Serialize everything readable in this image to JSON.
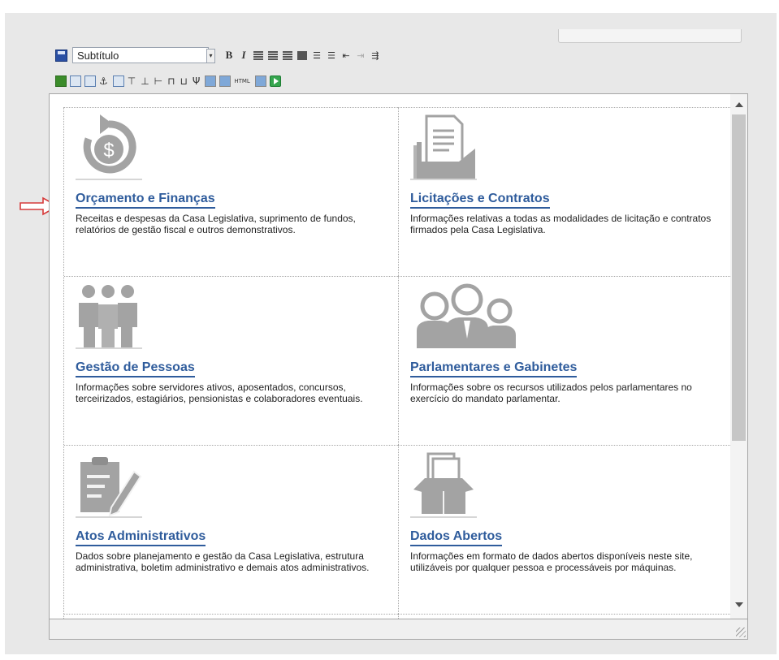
{
  "toolbar": {
    "style_select_value": "Subtítulo",
    "bold_label": "B",
    "italic_label": "I",
    "html_label": "HTML"
  },
  "cards": [
    {
      "title": "Orçamento e Finanças",
      "description": "Receitas e despesas da Casa Legislativa, suprimento de fundos, relatórios de gestão fiscal e outros demonstrativos.",
      "icon": "dollar-refresh-icon"
    },
    {
      "title": "Licitações e Contratos",
      "description": "Informações relativas a todas as modalidades de licitação e contratos firmados pela Casa Legislativa.",
      "icon": "folder-document-icon"
    },
    {
      "title": "Gestão de Pessoas",
      "description": "Informações sobre servidores ativos, aposentados, concursos, terceirizados, estagiários, pensionistas e colaboradores eventuais.",
      "icon": "people-group-icon"
    },
    {
      "title": "Parlamentares e Gabinetes",
      "description": "Informações sobre os recursos utilizados pelos parlamentares no exercício do mandato parlamentar.",
      "icon": "parliamentarians-icon"
    },
    {
      "title": "Atos Administrativos",
      "description": "Dados sobre planejamento e gestão da Casa Legislativa, estrutura administrativa, boletim administrativo e demais atos administrativos.",
      "icon": "clipboard-pencil-icon"
    },
    {
      "title": "Dados Abertos",
      "description": "Informações em formato de dados abertos disponíveis neste site, utilizáveis por qualquer pessoa e processáveis por máquinas.",
      "icon": "open-box-icon"
    }
  ],
  "colors": {
    "link_title": "#2f5c9c",
    "icon_gray": "#a3a3a3",
    "pointer_arrow": "#d63a3a"
  }
}
